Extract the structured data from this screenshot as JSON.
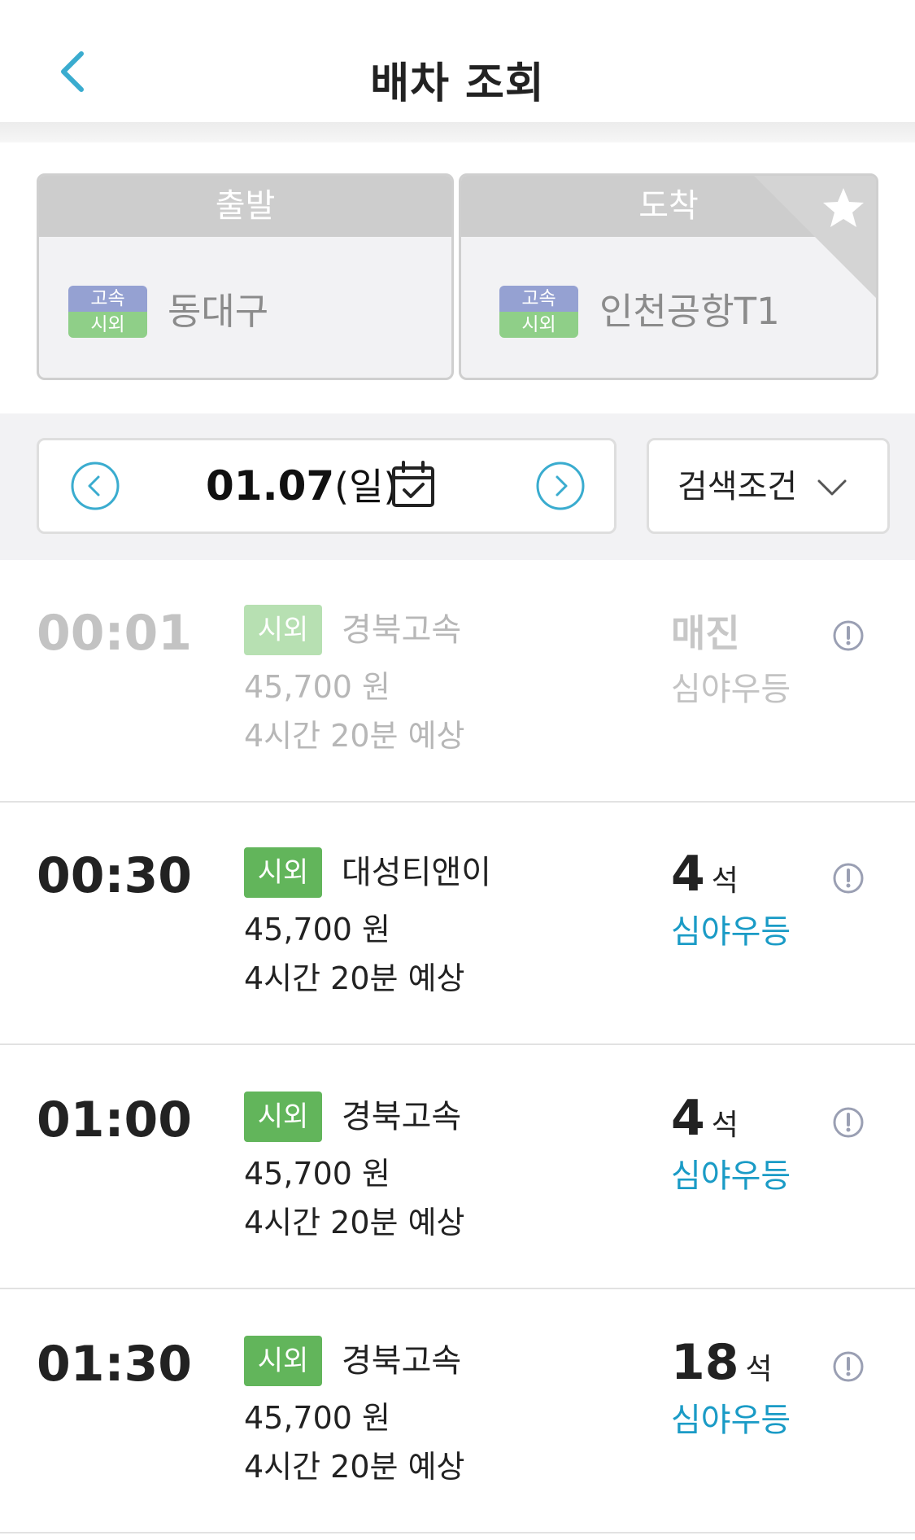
{
  "header": {
    "title": "배차 조회"
  },
  "route": {
    "departure": {
      "label": "출발",
      "badge_top": "고속",
      "badge_bottom": "시외",
      "place": "동대구"
    },
    "arrival": {
      "label": "도착",
      "badge_top": "고속",
      "badge_bottom": "시외",
      "place": "인천공항T1"
    }
  },
  "date_bar": {
    "date": "01.07",
    "day": "(일)"
  },
  "filter": {
    "label": "검색조건"
  },
  "buses": [
    {
      "time": "00:01",
      "type": "시외",
      "company": "경북고속",
      "price": "45,700 원",
      "duration": "4시간 20분 예상",
      "status": "매진",
      "grade": "심야우등"
    },
    {
      "time": "00:30",
      "type": "시외",
      "company": "대성티앤이",
      "price": "45,700 원",
      "duration": "4시간 20분 예상",
      "seats": "4",
      "seat_unit": "석",
      "grade": "심야우등"
    },
    {
      "time": "01:00",
      "type": "시외",
      "company": "경북고속",
      "price": "45,700 원",
      "duration": "4시간 20분 예상",
      "seats": "4",
      "seat_unit": "석",
      "grade": "심야우등"
    },
    {
      "time": "01:30",
      "type": "시외",
      "company": "경북고속",
      "price": "45,700 원",
      "duration": "4시간 20분 예상",
      "seats": "18",
      "seat_unit": "석",
      "grade": "심야우등"
    }
  ],
  "colors": {
    "accent": "#1a9bc6",
    "badge_green": "#62b55b",
    "badge_blue": "#95a1d2"
  }
}
